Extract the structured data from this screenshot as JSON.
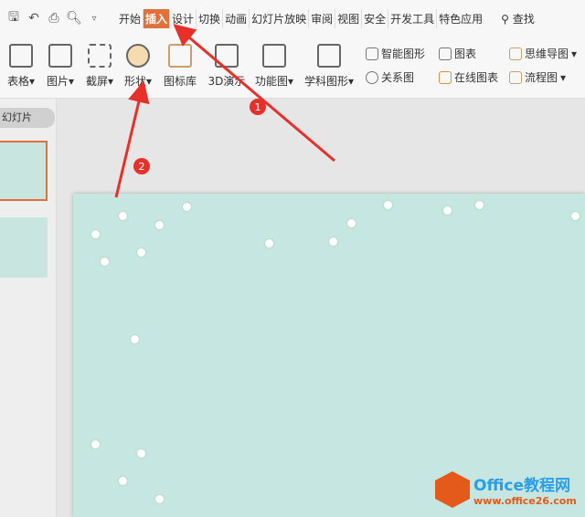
{
  "quick_access": [
    "save-icon",
    "undo-icon",
    "print-icon",
    "preview-icon",
    "dropdown-icon"
  ],
  "tabs": [
    "开始",
    "插入",
    "设计",
    "切换",
    "动画",
    "幻灯片放映",
    "审阅",
    "视图",
    "安全",
    "开发工具",
    "特色应用"
  ],
  "active_tab": "插入",
  "search_label": "查找",
  "ribbon": {
    "big": [
      "表格",
      "图片",
      "截屏",
      "形状",
      "图标库",
      "3D演示",
      "功能图",
      "学科图形"
    ],
    "small": [
      "智能图形",
      "关系图",
      "图表",
      "在线图表",
      "思维导图",
      "流程图"
    ]
  },
  "left_panel": {
    "header": "幻灯片"
  },
  "annotations": [
    "1",
    "2"
  ],
  "watermark": {
    "title": "Office教程网",
    "url": "www.office26.com"
  },
  "colors": {
    "accent": "#e0703c",
    "arrow": "#e8302a",
    "slide_bg": "#c6e6e1"
  }
}
